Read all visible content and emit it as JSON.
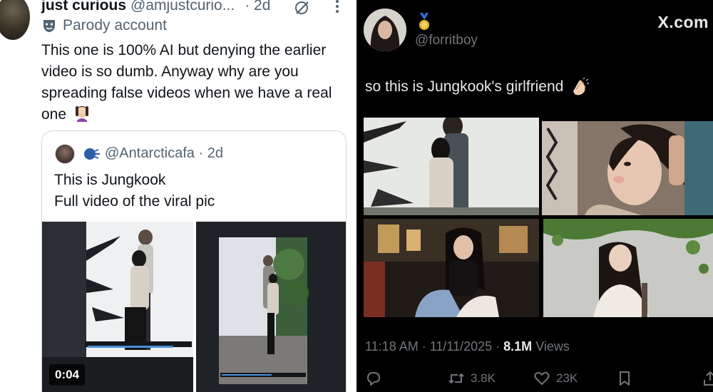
{
  "left_tweet": {
    "display_name": "just curious",
    "handle": "@amjustcurio...",
    "time": "· 2d",
    "badge": "Parody account",
    "text": "This one is 100% AI but denying the earlier video is so dumb. Anyway why are you spreading false videos when we have a real one",
    "emoji": "face-with-hand-over-mouth-icon",
    "quote": {
      "handle": "@Antarcticafa",
      "time": "· 2d",
      "line1": "This is Jungkook",
      "line2": "Full video of the viral pic",
      "video_timestamp": "0:04"
    }
  },
  "right_tweet": {
    "handle": "@forritboy",
    "watermark": "X.com",
    "text": "so this is Jungkook's girlfriend",
    "time": "11:18 AM · 11/11/2025 ·",
    "views_count": "8.1M",
    "views_label": "Views",
    "retweets": "3.8K",
    "likes": "23K"
  },
  "colors": {
    "light_bg": "#ffffff",
    "dark_bg": "#000000",
    "secondary_text": "#536471",
    "dark_secondary_text": "#71767b"
  }
}
